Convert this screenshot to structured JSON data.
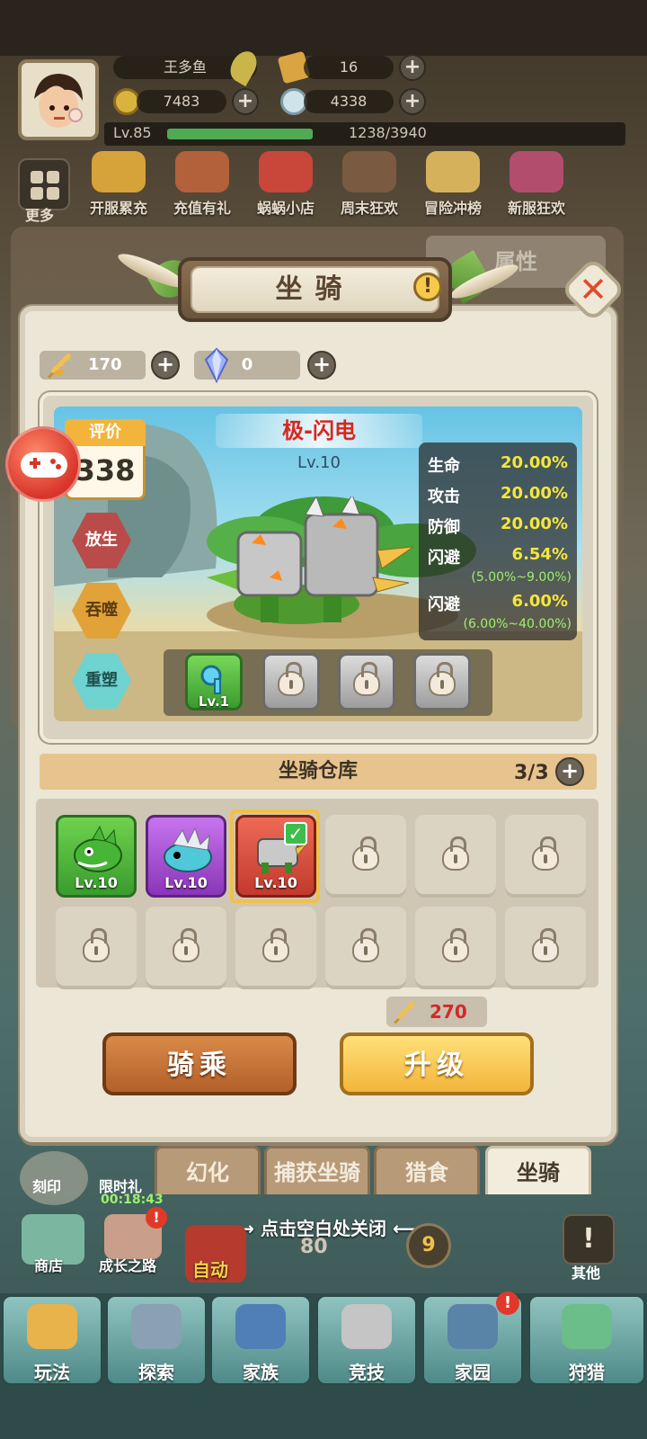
{
  "player": {
    "name": "王多鱼",
    "tickets": "16",
    "gold": "7483",
    "shells": "4338",
    "level": "Lv.85",
    "exp": "1238/3940"
  },
  "hud_menu": {
    "more": "更多",
    "events": [
      "开服累充",
      "充值有礼",
      "蜗蜗小店",
      "周末狂欢",
      "冒险冲榜",
      "新服狂欢"
    ]
  },
  "bg_tab_right": "属性",
  "panel": {
    "title": "坐骑",
    "wheat_amount": "170",
    "crystal_amount": "0"
  },
  "mount": {
    "name": "极-闪电",
    "level": "Lv.10",
    "rating_label": "评价",
    "rating_value": "338",
    "actions": [
      "放生",
      "吞噬",
      "重塑"
    ],
    "stats": [
      {
        "label": "生命",
        "value": "20.00%"
      },
      {
        "label": "攻击",
        "value": "20.00%"
      },
      {
        "label": "防御",
        "value": "20.00%"
      },
      {
        "label": "闪避",
        "value": "6.54%",
        "range": "(5.00%~9.00%)"
      },
      {
        "label": "闪避",
        "value": "6.00%",
        "range": "(6.00%~40.00%)"
      }
    ],
    "skill_level": "Lv.1"
  },
  "warehouse": {
    "title": "坐骑仓库",
    "count": "3/3",
    "mounts": [
      {
        "level": "Lv.10",
        "color": "#4caa3c"
      },
      {
        "level": "Lv.10",
        "color": "#a74fd0"
      },
      {
        "level": "Lv.10",
        "color": "#d84a3a"
      }
    ]
  },
  "upgrade_cost": "270",
  "buttons": {
    "ride": "骑乘",
    "upgrade": "升级"
  },
  "tabs": [
    "幻化",
    "捕获坐骑",
    "猎食",
    "坐骑"
  ],
  "close_hint": "点击空白处关闭",
  "bg_hud": {
    "engrave": "刻印",
    "limited": "限时礼",
    "timer": "00:18:43",
    "shop": "商店",
    "growth": "成长之路",
    "auto": "自动",
    "stage": "80",
    "stage_badge": "9",
    "other": "其他"
  },
  "bottom_nav": [
    "玩法",
    "探索",
    "家族",
    "竞技",
    "家园",
    "狩猎"
  ],
  "colors": {
    "accent_red": "#d9271d",
    "stat_yellow": "#f6e63b",
    "range_green": "#9ff06d",
    "ride_button": "#c57636",
    "upgrade_button": "#f6c54a"
  }
}
